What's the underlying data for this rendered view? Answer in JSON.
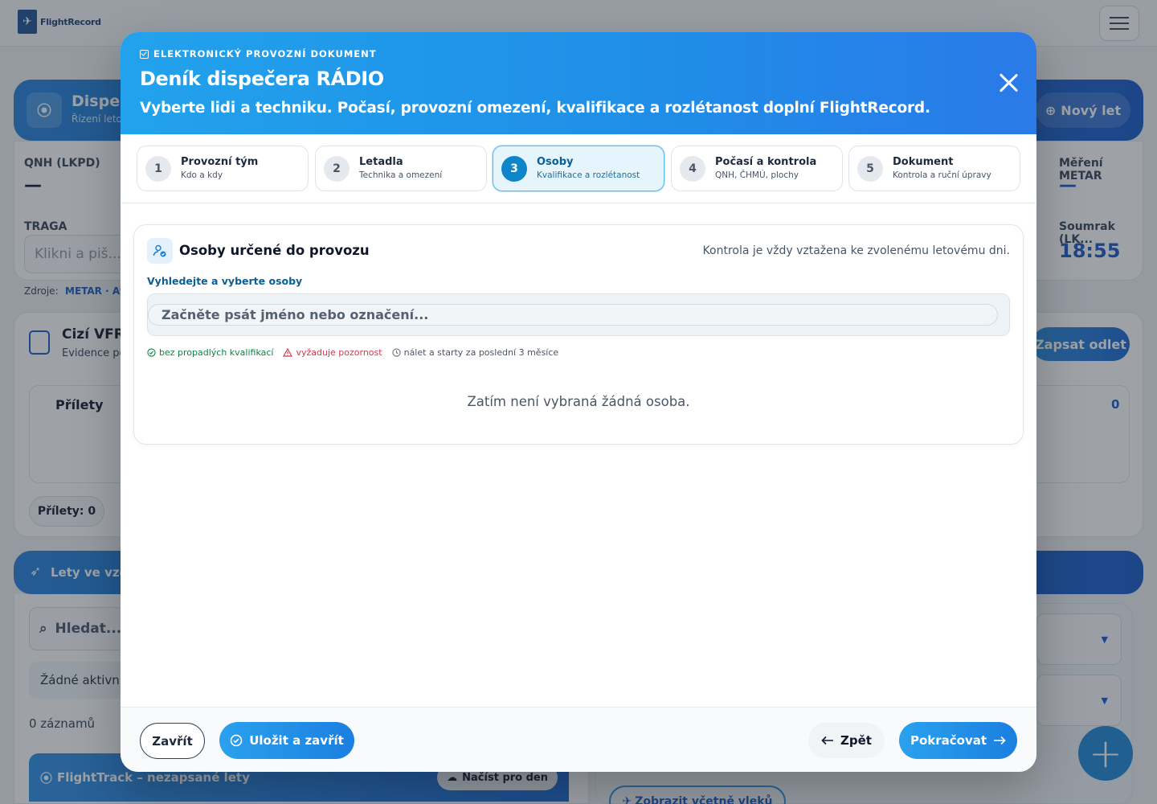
{
  "background": {
    "logo_text": "FlightRecord",
    "dispatch_title": "Dispeč",
    "dispatch_sub": "Řízení leto",
    "new_flight_label": "Nový let",
    "qnh_label": "QNH (LKPD)",
    "qnh_value": "—",
    "metar_label": "Měření METAR",
    "metar_value": "—",
    "traga_label": "TRAGA",
    "traga_placeholder": "Klikni a piš...",
    "sunset_label": "Soumrak (LK...",
    "sunset_value": "18:55",
    "source_label": "Zdroje:",
    "source_value": "METAR · Avia",
    "foreign_title": "Cizí VFR",
    "foreign_sub": "Evidence po",
    "log_departure_label": "Zapsat odlet",
    "arrivals_title": "Přílety",
    "arrivals_count": "0",
    "arrivals_pill": "Přílety: 0",
    "flights_band": "Lety ve vzd",
    "search_placeholder": "Hledat...",
    "no_active": "Žádné aktivní",
    "records": "0 záznamů",
    "flighttrack_label": "FlightTrack – nezapsané lety",
    "load_day_label": "Načíst pro den",
    "show_tows_label": "Zobrazit včetně vleků"
  },
  "modal": {
    "eyebrow": "ELEKTRONICKÝ PROVOZNÍ DOKUMENT",
    "title": "Deník dispečera RÁDIO",
    "subtitle": "Vyberte lidi a techniku. Počasí, provozní omezení, kvalifikace a rozlétanost doplní FlightRecord.",
    "steps": [
      {
        "num": "1",
        "title": "Provozní tým",
        "sub": "Kdo a kdy"
      },
      {
        "num": "2",
        "title": "Letadla",
        "sub": "Technika a omezení"
      },
      {
        "num": "3",
        "title": "Osoby",
        "sub": "Kvalifikace a rozlétanost"
      },
      {
        "num": "4",
        "title": "Počasí a kontrola",
        "sub": "QNH, ČHMÚ, plochy"
      },
      {
        "num": "5",
        "title": "Dokument",
        "sub": "Kontrola a ruční úpravy"
      }
    ],
    "section": {
      "title": "Osoby určené do provozu",
      "note": "Kontrola je vždy vztažena ke zvolenému letovému dni.",
      "search_label": "Vyhledejte a vyberte osoby",
      "search_placeholder": "Začněte psát jméno nebo označení...",
      "legend": {
        "ok": "bez propadlých kvalifikací",
        "warn": "vyžaduje pozornost",
        "time": "nálet a starty za poslední 3 měsíce"
      },
      "empty": "Zatím není vybraná žádná osoba."
    },
    "footer": {
      "close": "Zavřít",
      "save": "Uložit a zavřít",
      "back": "Zpět",
      "next": "Pokračovat"
    }
  },
  "colors": {
    "accent": "#1f8fe8",
    "active_step": "#0f85c9",
    "ok": "#14804a",
    "warn": "#d23b4e"
  }
}
